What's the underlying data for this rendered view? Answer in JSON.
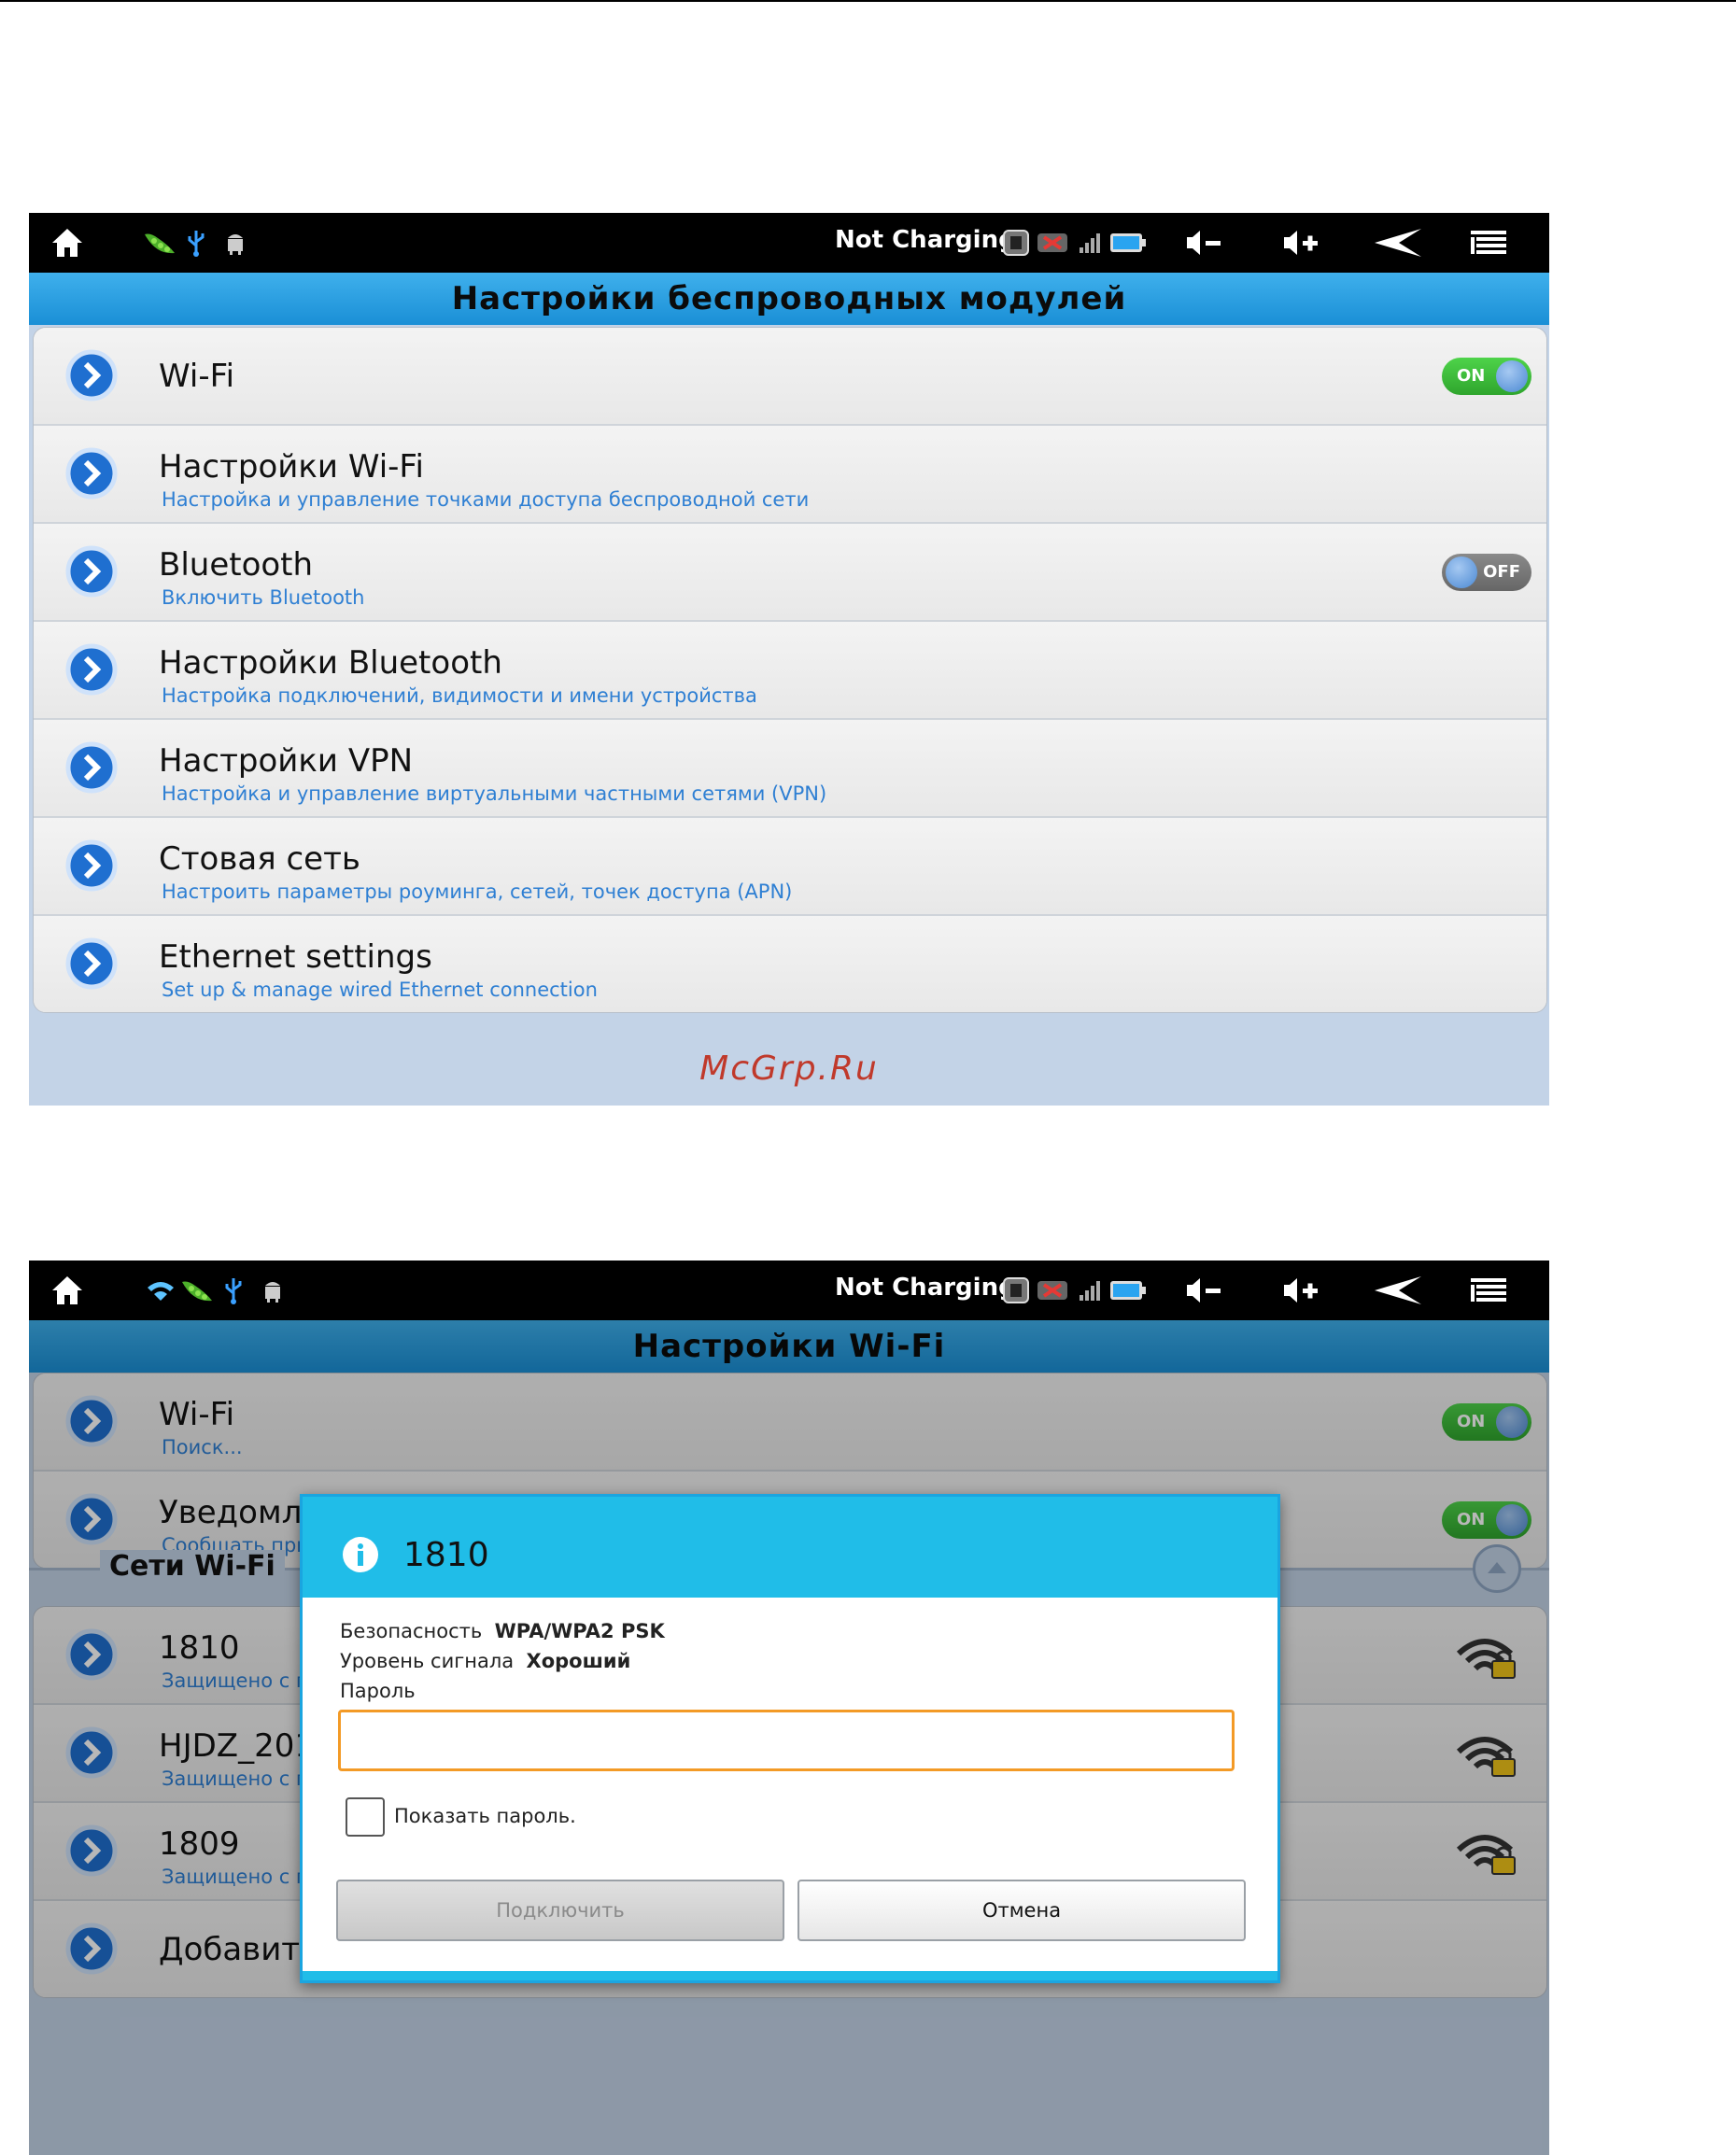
{
  "screen1": {
    "status": {
      "charging_text": "Not Charging",
      "icons": [
        "home-icon",
        "pea-icon",
        "usb-icon",
        "android-debug-icon",
        "sd-icon",
        "no-signal-icon",
        "signal-bars-icon",
        "battery-icon",
        "volume-down-icon",
        "volume-up-icon",
        "back-icon",
        "menu-icon"
      ]
    },
    "title": "Настройки беспроводных модулей",
    "items": [
      {
        "title": "Wi-Fi",
        "subtitle": "",
        "toggle": "ON"
      },
      {
        "title": "Настройки Wi-Fi",
        "subtitle": "Настройка и управление точками доступа беспроводной сети"
      },
      {
        "title": "Bluetooth",
        "subtitle": "Включить Bluetooth",
        "toggle": "OFF"
      },
      {
        "title": "Настройки Bluetooth",
        "subtitle": "Настройка подключений, видимости и имени устройства"
      },
      {
        "title": "Настройки VPN",
        "subtitle": "Настройка и управление виртуальными частными сетями (VPN)"
      },
      {
        "title": "Стовая сеть",
        "subtitle": "Настроить параметры роуминга, сетей, точек доступа (APN)"
      },
      {
        "title": "Ethernet settings",
        "subtitle": "Set up & manage wired Ethernet connection"
      }
    ],
    "watermark": "McGrp.Ru"
  },
  "screen2": {
    "status": {
      "charging_text": "Not Charging",
      "icons": [
        "wifi-status-icon",
        "pea-icon",
        "usb-icon",
        "android-debug-icon",
        "sd-icon",
        "no-signal-icon",
        "signal-bars-icon",
        "battery-icon",
        "volume-down-icon",
        "volume-up-icon",
        "back-icon",
        "menu-icon"
      ]
    },
    "title": "Настройки Wi-Fi",
    "top_items": [
      {
        "title": "Wi-Fi",
        "subtitle": "Поиск...",
        "toggle": "ON"
      },
      {
        "title": "Уведомле",
        "subtitle": "Сообщать при",
        "toggle": "ON"
      }
    ],
    "section_label": "Сети Wi-Fi",
    "networks": [
      {
        "title": "1810",
        "subtitle": "Защищено с п"
      },
      {
        "title": "HJDZ_201",
        "subtitle": "Защищено с п"
      },
      {
        "title": "1809",
        "subtitle": "Защищено с п"
      }
    ],
    "add_network": "Добавить сеть Wi-Fi",
    "dialog": {
      "title": "1810",
      "security_label": "Безопасность",
      "security_value": "WPA/WPA2 PSK",
      "signal_label": "Уровень сигнала",
      "signal_value": "Хороший",
      "password_label": "Пароль",
      "password_value": "",
      "show_password_label": "Показать пароль.",
      "show_password_checked": false,
      "connect_label": "Подключить",
      "cancel_label": "Отмена"
    }
  },
  "colors": {
    "accent_blue": "#1a8fd6",
    "dialog_header": "#20bde8",
    "subtitle_blue": "#2e7fd3",
    "toggle_on": "#2fa52d",
    "input_focus": "#f39a26",
    "watermark": "#c0392b"
  }
}
